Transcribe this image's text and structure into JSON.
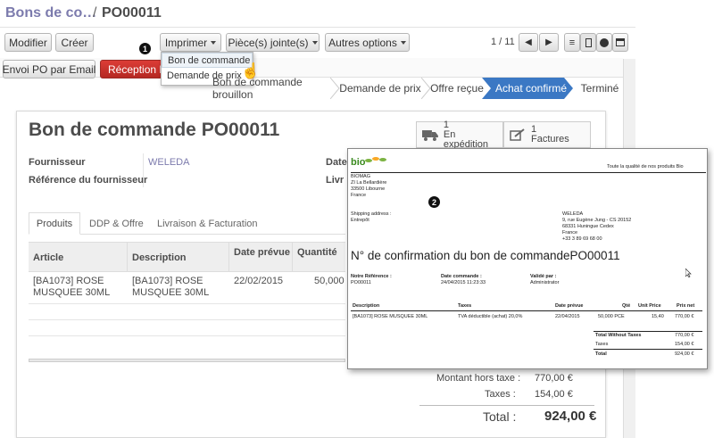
{
  "breadcrumb": {
    "parent": "Bons de co…",
    "separator": "/",
    "current": "PO00011"
  },
  "toolbar": {
    "modifier": "Modifier",
    "creer": "Créer",
    "imprimer": "Imprimer",
    "pieces": "Pièce(s) jointe(s)",
    "autres": "Autres options",
    "pager": "1 / 11"
  },
  "dropdown": {
    "items": [
      "Bon de commande",
      "Demande de prix"
    ]
  },
  "callouts": {
    "one": "1",
    "two": "2"
  },
  "actions": {
    "envoi": "Envoi PO par Email",
    "reception": "Réception Fa"
  },
  "stages": [
    "Bon de commande brouillon",
    "Demande de prix",
    "Offre reçue",
    "Achat confirmé",
    "Terminé"
  ],
  "form": {
    "title": "Bon de commande PO00011",
    "fournisseur_label": "Fournisseur",
    "fournisseur_value": "WELEDA",
    "ref_label": "Référence du fournisseur",
    "date_label": "Date",
    "livr_label": "Livr"
  },
  "smart": {
    "exp_count": "1",
    "exp_label": "En expédition",
    "fact_count": "1",
    "fact_label": "Factures"
  },
  "tabs": [
    "Produits",
    "DDP & Offre",
    "Livraison & Facturation"
  ],
  "table": {
    "headers": [
      "Article",
      "Description",
      "Date prévue",
      "Quantité"
    ],
    "rows": [
      {
        "article": "[BA1073] ROSE MUSQUEE 30ML",
        "description": "[BA1073] ROSE MUSQUEE 30ML",
        "date": "22/02/2015",
        "qty": "50,000"
      }
    ]
  },
  "totals": {
    "ht_label": "Montant hors taxe :",
    "ht_value": "770,00 €",
    "tax_label": "Taxes :",
    "tax_value": "154,00 €",
    "total_label": "Total :",
    "total_value": "924,00 €"
  },
  "doc": {
    "logo": "bio",
    "tagline": "Toute la qualité de nos produits Bio",
    "company": [
      "BIOMAG",
      "ZI La Bellardière",
      "33500 Libourne",
      "France"
    ],
    "shipping_label": "Shipping address :",
    "shipping_value": "Entrepôt",
    "supplier": [
      "WELEDA",
      "9, rue Eugène Jung - CS 20152",
      "68331 Huningue Cedex",
      "France",
      "+33 3 89 69 68 00"
    ],
    "title": "N° de confirmation du bon de commandePO00011",
    "ref_label": "Notre Référence :",
    "ref_value": "PO00011",
    "date_label": "Date commande :",
    "date_value": "24/04/2015 11:23:33",
    "valid_label": "Validé par :",
    "valid_value": "Administrator",
    "headers": [
      "Description",
      "Taxes",
      "Date prévue",
      "Qté",
      "Unit Price",
      "Prix net"
    ],
    "row": [
      "[BA1073] ROSE MUSQUEE 30ML",
      "TVA déductible (achat) 20,0%",
      "22/04/2015",
      "50,000 PCE",
      "15,40",
      "770,00 €"
    ],
    "tot_wo_label": "Total Without Taxes",
    "tot_wo_value": "770,00 €",
    "taxes_label": "Taxes",
    "taxes_value": "154,00 €",
    "total_label": "Total",
    "total_value": "924,00 €"
  },
  "colors": {
    "accent": "#7c7bad",
    "stage_active": "#3b78c4",
    "danger": "#c9302c"
  }
}
